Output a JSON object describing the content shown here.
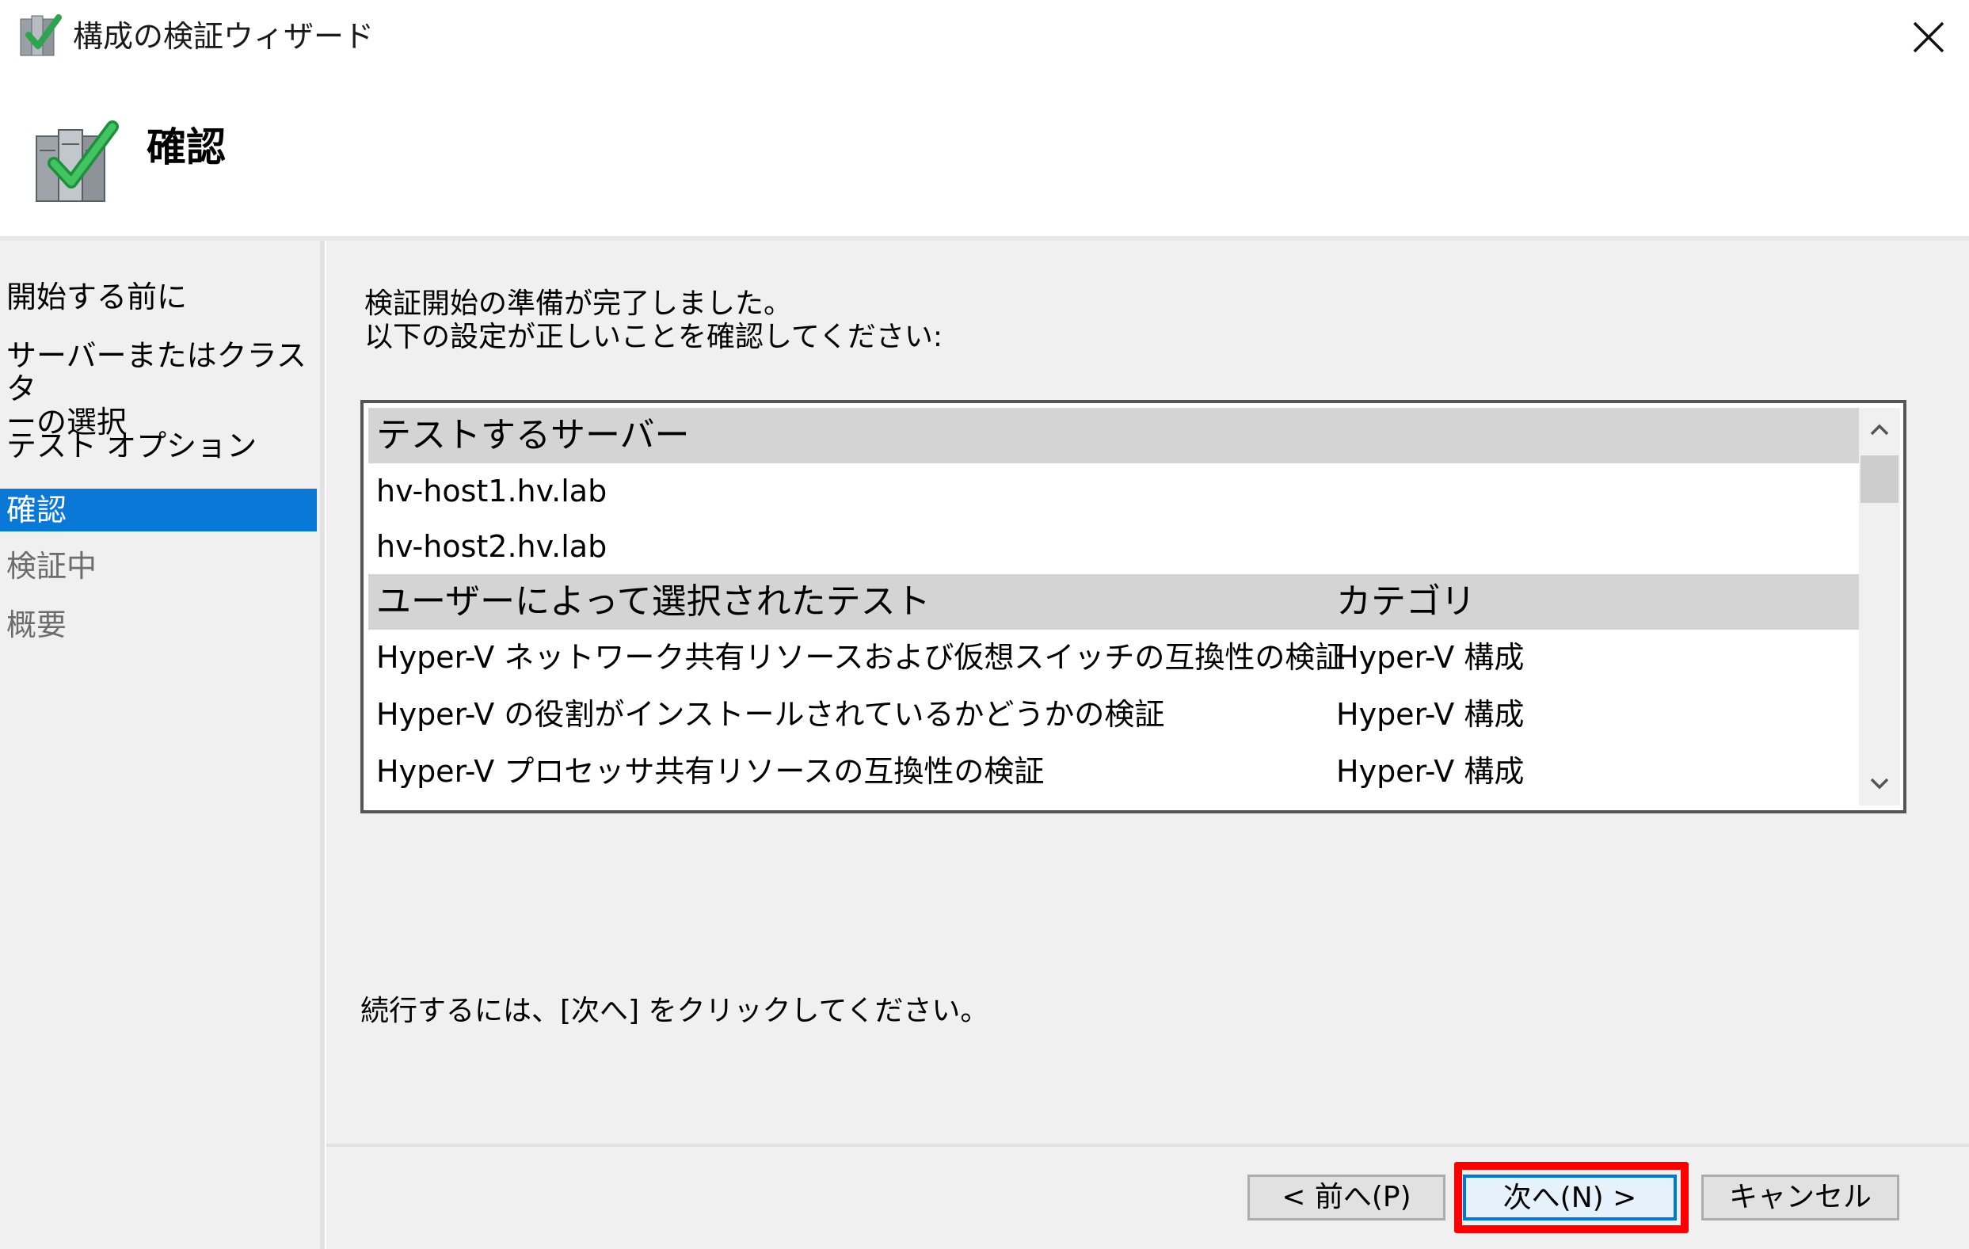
{
  "window": {
    "title": "構成の検証ウィザード",
    "icon": "validate-config-wizard-icon",
    "close_icon": "close-icon"
  },
  "header": {
    "title": "確認",
    "icon": "servers-check-icon"
  },
  "nav": {
    "items": [
      {
        "label": "開始する前に",
        "state": "normal"
      },
      {
        "label_line1": "サーバーまたはクラスタ",
        "label_line2": "ーの選択",
        "state": "normal"
      },
      {
        "label": "テスト オプション",
        "state": "normal"
      },
      {
        "label": "確認",
        "state": "selected"
      },
      {
        "label": "検証中",
        "state": "disabled"
      },
      {
        "label": "概要",
        "state": "disabled"
      }
    ]
  },
  "content": {
    "intro_line1": "検証開始の準備が完了しました。",
    "intro_line2": "以下の設定が正しいことを確認してください:",
    "list": {
      "servers_header": "テストするサーバー",
      "servers": [
        "hv-host1.hv.lab",
        "hv-host2.hv.lab"
      ],
      "tests_header": "ユーザーによって選択されたテスト",
      "category_header": "カテゴリ",
      "tests": [
        {
          "name": "Hyper-V ネットワーク共有リソースおよび仮想スイッチの互換性の検証",
          "category": "Hyper-V 構成"
        },
        {
          "name": "Hyper-V の役割がインストールされているかどうかの検証",
          "category": "Hyper-V 構成"
        },
        {
          "name": "Hyper-V プロセッサ共有リソースの互換性の検証",
          "category": "Hyper-V 構成"
        }
      ]
    },
    "continue_text": "続行するには、[次へ] をクリックしてください。"
  },
  "footer": {
    "prev_label": "< 前へ(P)",
    "next_label": "次へ(N) >",
    "cancel_label": "キャンセル"
  },
  "colors": {
    "selection": "#0a78d7",
    "panel": "#f0f0f0",
    "list_header": "#d4d4d4",
    "highlight": "#ff0000",
    "default_button_border": "#0078d7"
  }
}
